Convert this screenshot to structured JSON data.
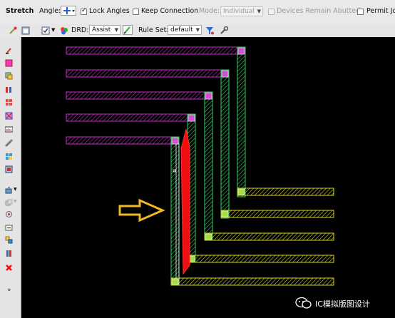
{
  "toolbar": {
    "mode_title": "Stretch",
    "angle_label": "Angle:",
    "lock_angles_label": "Lock Angles",
    "lock_angles_checked": true,
    "keep_connection_label": "Keep Connection",
    "keep_connection_checked": false,
    "mode_label": "Mode:",
    "mode_value": "Individual",
    "devices_abutted_label": "Devices Remain Abutted",
    "permit_label": "Permit Jo"
  },
  "toolbar2": {
    "drd_label": "DRD:",
    "drd_value": "Assist",
    "ruleset_label": "Rule Set:",
    "ruleset_value": "default"
  },
  "canvas": {
    "background": "#000000",
    "colors": {
      "purple": "#c030c0",
      "green": "#30d060",
      "yellow": "#d8d820",
      "red": "#ee1010",
      "arrow": "#f0b820"
    }
  },
  "watermark": {
    "text": "IC模拟版图设计"
  }
}
